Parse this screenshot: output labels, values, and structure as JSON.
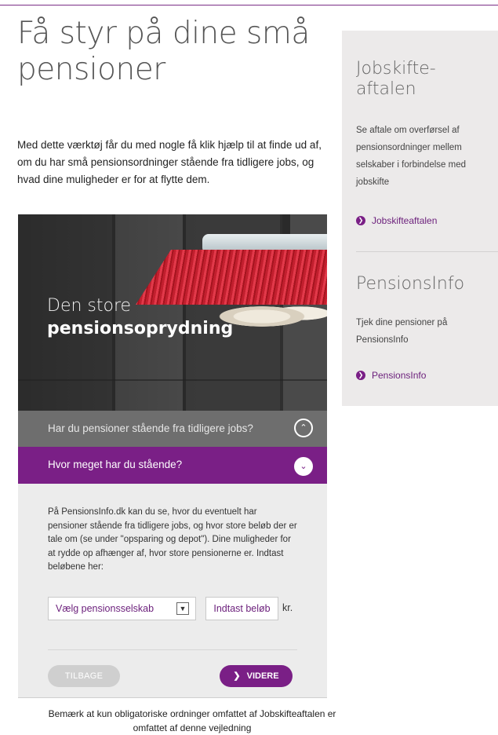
{
  "page": {
    "title_line1": "Få styr på dine små",
    "title_line2": "pensioner",
    "intro": "Med dette værktøj får du med nogle få klik hjælp til at finde ud af, om du har små pensionsordninger stående fra tidligere jobs, og hvad dine muligheder er for at flytte dem."
  },
  "hero": {
    "line1": "Den store",
    "line2": "pensionsoprydning"
  },
  "accordion": {
    "item1_label": "Har du pensioner stående fra tidligere jobs?",
    "item2_label": "Hvor meget har du stående?"
  },
  "panel": {
    "description": "På PensionsInfo.dk kan du se, hvor du eventuelt har pensioner stående fra tidligere jobs, og hvor store beløb der er tale om (se under \"opsparing og depot\"). Dine muligheder for at rydde op afhænger af, hvor store pensionerne er. Indtast beløbene her:",
    "select_value": "Vælg pensionsselskab",
    "amount_placeholder": "Indtast beløb",
    "unit": "kr.",
    "back_label": "TILBAGE",
    "next_label": "VIDERE"
  },
  "note": "Bemærk at kun obligatoriske ordninger omfattet af Jobskifteaftalen er omfattet af denne vejledning",
  "sidebar": {
    "box1": {
      "heading_line1": "Jobskifte-",
      "heading_line2": "aftalen",
      "text": "Se aftale om overførsel af pensionsordninger mellem selskaber i forbindelse med jobskifte",
      "link": "Jobskifteaftalen"
    },
    "box2": {
      "heading": "PensionsInfo",
      "text": "Tjek dine pensioner på PensionsInfo",
      "link": "PensionsInfo"
    }
  },
  "colors": {
    "brand_purple": "#7a1f86",
    "accordion_gray": "#6e6e6e",
    "sidebar_bg": "#eceaea"
  },
  "icons": {
    "accordion_item1": "chevron-up-icon",
    "accordion_item2": "chevron-down-icon",
    "select": "dropdown-arrow-icon",
    "links": "arrow-circle-icon"
  }
}
